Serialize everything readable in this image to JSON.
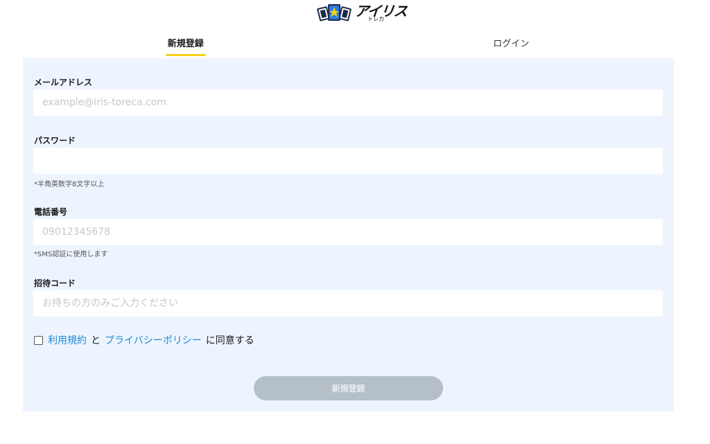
{
  "brand": {
    "name_main": "アイリス",
    "name_sub": "トレカ",
    "colors": {
      "logo_dark": "#1b2a4a",
      "logo_yellow": "#f7d117",
      "logo_blue": "#2a7de1"
    }
  },
  "tabs": [
    {
      "label": "新規登録",
      "active": true
    },
    {
      "label": "ログイン",
      "active": false
    }
  ],
  "form": {
    "email": {
      "label": "メールアドレス",
      "placeholder": "example@iris-toreca.com",
      "value": ""
    },
    "password": {
      "label": "パスワード",
      "placeholder": "",
      "value": "",
      "hint": "*半角英数字8文字以上"
    },
    "phone": {
      "label": "電話番号",
      "placeholder": "09012345678",
      "value": "",
      "hint": "*SMS認証に使用します"
    },
    "invite": {
      "label": "招待コード",
      "placeholder": "お持ちの方のみご入力ください",
      "value": ""
    },
    "agreement": {
      "checked": false,
      "terms_link": "利用規約",
      "connector": "と",
      "privacy_link": "プライバシーポリシー",
      "suffix": "に同意する"
    },
    "submit_label": "新規登録"
  },
  "colors": {
    "panel_bg": "#edf4fe",
    "accent_underline": "#f7d117",
    "link": "#1e8ad3",
    "button_disabled": "#b5bfc8"
  }
}
